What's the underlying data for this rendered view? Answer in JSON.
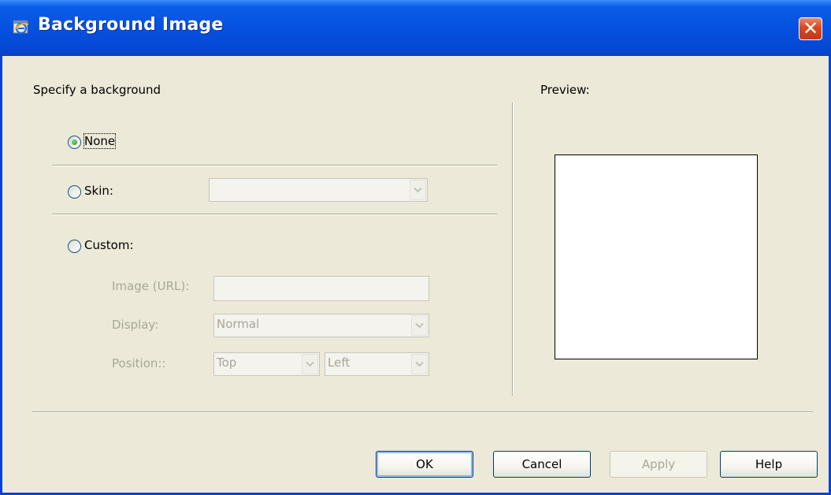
{
  "window": {
    "title": "Background Image",
    "icon": "ie-icon",
    "close_symbol": "✕"
  },
  "specify_label": "Specify a background",
  "options": {
    "none": {
      "label": "None",
      "selected": true
    },
    "skin": {
      "label": "Skin:",
      "selected": false,
      "value": ""
    },
    "custom": {
      "label": "Custom:",
      "selected": false
    }
  },
  "custom": {
    "image_label": "Image (URL):",
    "image_value": "",
    "display_label": "Display:",
    "display_value": "Normal",
    "position_label": "Position::",
    "position_vertical": "Top",
    "position_horizontal": "Left"
  },
  "preview_label": "Preview:",
  "buttons": {
    "ok": "OK",
    "cancel": "Cancel",
    "apply": "Apply",
    "help": "Help"
  },
  "colors": {
    "titlebar": "#0551e1",
    "dialog_bg": "#ece9d8",
    "selected_radio": "#21a121",
    "disabled_text": "#a8a695"
  }
}
